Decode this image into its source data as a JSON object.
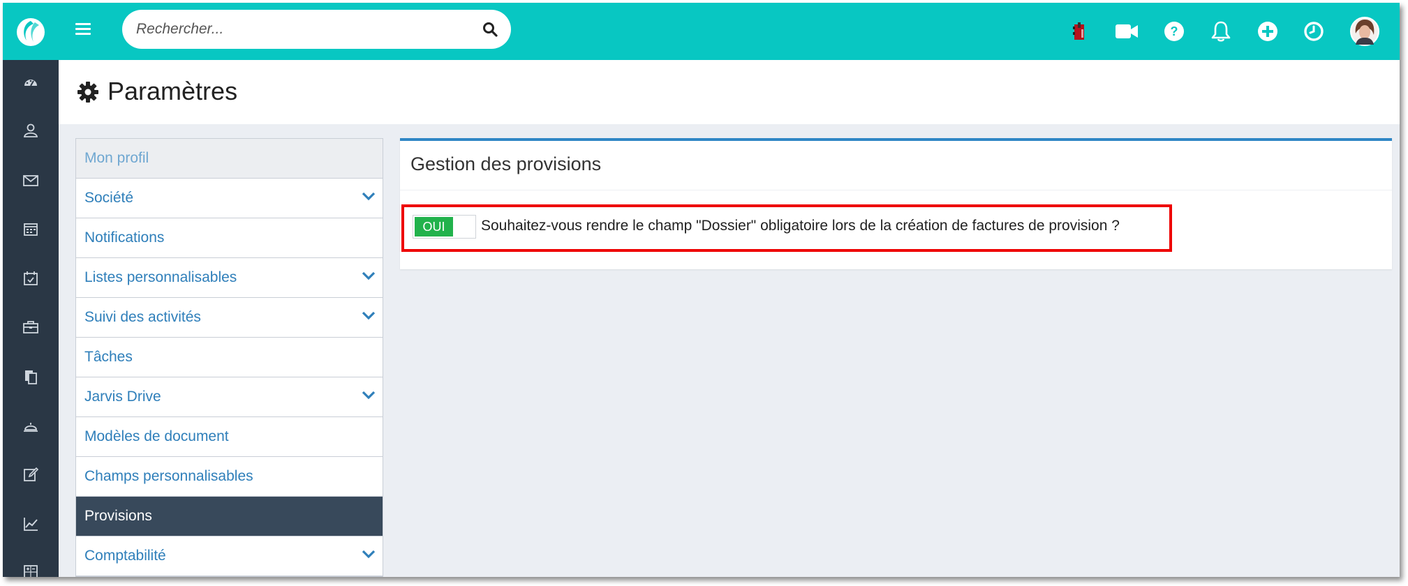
{
  "search": {
    "placeholder": "Rechercher..."
  },
  "topbar": {
    "icons": [
      "agenda-icon",
      "video-icon",
      "help-icon",
      "bell-icon",
      "add-icon",
      "clock-icon",
      "user-avatar"
    ]
  },
  "sidebar": {
    "icons": [
      "dashboard-icon",
      "contacts-icon",
      "mail-icon",
      "calendar-icon",
      "tasks-calendar-icon",
      "briefcase-icon",
      "documents-icon",
      "reception-bell-icon",
      "edit-icon",
      "chart-icon",
      "calculator-icon"
    ]
  },
  "page": {
    "title": "Paramètres"
  },
  "menu": {
    "items": [
      {
        "label": "Mon profil",
        "chevron": false
      },
      {
        "label": "Société",
        "chevron": true
      },
      {
        "label": "Notifications",
        "chevron": false
      },
      {
        "label": "Listes personnalisables",
        "chevron": true
      },
      {
        "label": "Suivi des activités",
        "chevron": true
      },
      {
        "label": "Tâches",
        "chevron": false
      },
      {
        "label": "Jarvis Drive",
        "chevron": true
      },
      {
        "label": "Modèles de document",
        "chevron": false
      },
      {
        "label": "Champs personnalisables",
        "chevron": false
      },
      {
        "label": "Provisions",
        "chevron": false,
        "active": true
      },
      {
        "label": "Comptabilité",
        "chevron": true
      }
    ]
  },
  "panel": {
    "title": "Gestion des provisions",
    "toggle_label": "OUI",
    "toggle_state": "on",
    "question": "Souhaitez-vous rendre le champ \"Dossier\" obligatoire lors de la création de factures de provision ?"
  },
  "colors": {
    "topbar": "#08c7c2",
    "sidebar": "#2a3745",
    "active_menu": "#38495b",
    "link": "#2f7fba",
    "toggle_on": "#22b24c",
    "highlight": "#ee0000",
    "panel_accent": "#2f86c5"
  }
}
